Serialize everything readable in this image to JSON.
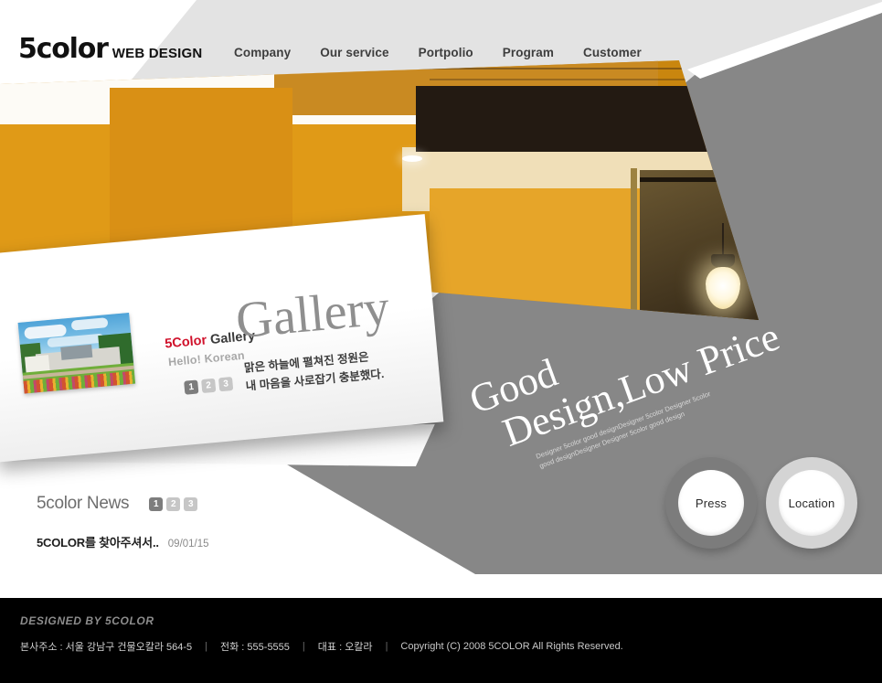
{
  "header": {
    "logo_main": "5color",
    "logo_sub": "WEB DESIGN",
    "nav": [
      {
        "label": "Company"
      },
      {
        "label": "Our service"
      },
      {
        "label": "Portpolio"
      },
      {
        "label": "Program"
      },
      {
        "label": "Customer"
      }
    ]
  },
  "hero": {
    "image_alt": "interior-orange-wall-pendant-lamps"
  },
  "gallery": {
    "brand_red": "5Color",
    "brand_dark": " Gallery",
    "hello": "Hello! Korean",
    "big_title": "Gallery",
    "description_line1": "맑은 하늘에 펼쳐진 정원은",
    "description_line2": "내 마음을 사로잡기 충분했다.",
    "pager": [
      {
        "label": "1",
        "active": true
      },
      {
        "label": "2",
        "active": false
      },
      {
        "label": "3",
        "active": false
      }
    ],
    "thumb_alt": "garden-park-photo"
  },
  "promo": {
    "line1": "Good",
    "line2": "Design,Low Price",
    "subtext": "Designer 5color good designDesigner 5color Designer 5color good designDesigner Designer 5color good design"
  },
  "buttons": {
    "press": "Press",
    "location": "Location"
  },
  "news": {
    "title": "5color News",
    "pager": [
      {
        "label": "1",
        "active": true
      },
      {
        "label": "2",
        "active": false
      },
      {
        "label": "3",
        "active": false
      }
    ],
    "items": [
      {
        "title": "5COLOR를 찾아주셔서..",
        "date": "09/01/15"
      }
    ]
  },
  "footer": {
    "brand": "DESIGNED BY 5COLOR",
    "address": "본사주소 : 서울 강남구 건물오칼라 564-5",
    "phone": "전화 : 555-5555",
    "ceo": "대표 : 오칼라",
    "copyright": "Copyright (C) 2008 5COLOR All Rights Reserved.",
    "separator": "|"
  },
  "colors": {
    "orange": "#d8901a",
    "gray_panel": "#878787",
    "header_band": "#e3e3e3",
    "accent_red": "#d0112b",
    "footer_bg": "#000000"
  }
}
